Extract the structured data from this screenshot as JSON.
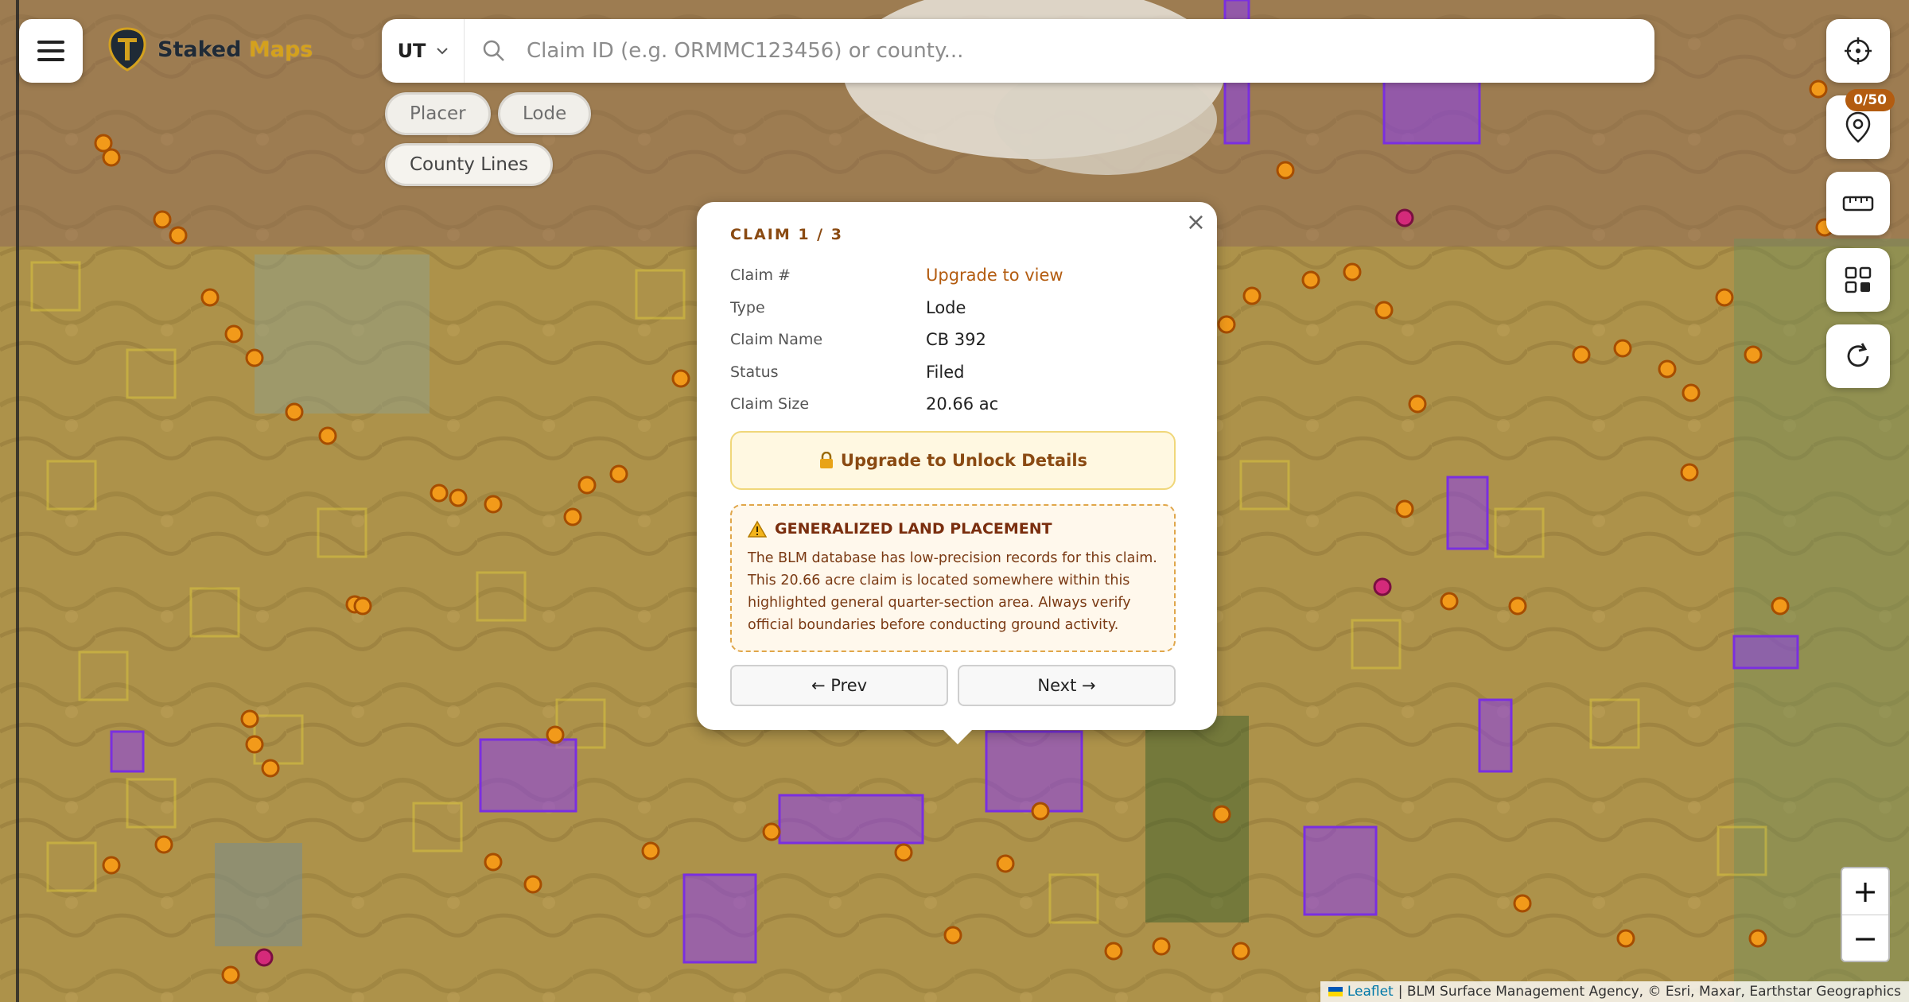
{
  "app": {
    "logo_main": "Staked",
    "logo_accent": "Maps"
  },
  "search": {
    "state": "UT",
    "placeholder": "Claim ID (e.g. ORMMC123456) or county..."
  },
  "filters": {
    "placer": "Placer",
    "lode": "Lode",
    "county_lines": "County Lines"
  },
  "toolbar": {
    "pin_count": "0/50"
  },
  "popup": {
    "title": "CLAIM 1 / 3",
    "rows": [
      {
        "label": "Claim #",
        "value": "Upgrade to view"
      },
      {
        "label": "Type",
        "value": "Lode"
      },
      {
        "label": "Claim Name",
        "value": "CB 392"
      },
      {
        "label": "Status",
        "value": "Filed"
      },
      {
        "label": "Claim Size",
        "value": "20.66 ac"
      }
    ],
    "unlock_label": "Upgrade to Unlock Details",
    "warning_title": "GENERALIZED LAND PLACEMENT",
    "warning_body": "The BLM database has low-precision records for this claim. This 20.66 acre claim is located somewhere within this highlighted general quarter-section area. Always verify official boundaries before conducting ground activity.",
    "prev_label": "← Prev",
    "next_label": "Next →",
    "close_label": "×"
  },
  "zoom": {
    "in": "+",
    "out": "−"
  },
  "attribution": {
    "leaflet": "Leaflet",
    "text": "| BLM Surface Management Agency, © Esri, Maxar, Earthstar Geographics"
  },
  "colors": {
    "accent": "#b35c10",
    "claim_purple": "#8b3cf0",
    "claim_orange": "#f29a1a",
    "blm_yellow": "#d9c13a",
    "logo_gold": "#d4a11d"
  }
}
